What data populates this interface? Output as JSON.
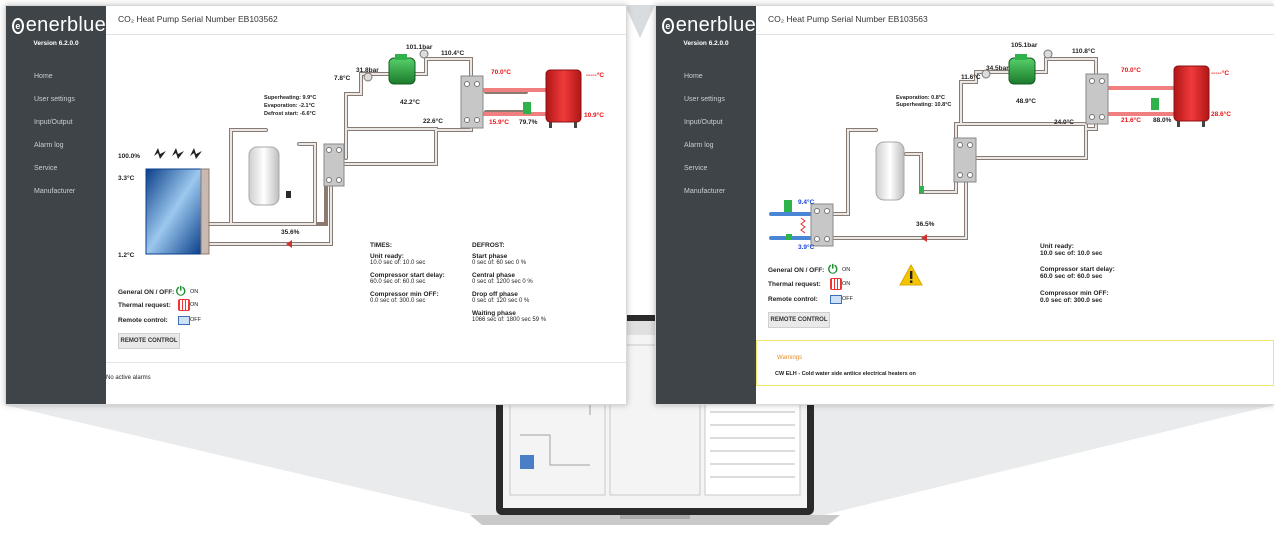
{
  "brand": {
    "logo_text": "enerblue",
    "logo_mark": "e",
    "version": "Version 6.2.0.0"
  },
  "nav": [
    "Home",
    "User settings",
    "Input/Output",
    "Alarm log",
    "Service",
    "Manufacturer"
  ],
  "left": {
    "title": "CO₂ Heat Pump Serial Number EB103562",
    "labels": {
      "p_high": "101.1bar",
      "t_discharge": "110.4°C",
      "p_low": "31.8bar",
      "t_suction": "7.8°C",
      "t_comp": "42.2°C",
      "t_supply": "70.0°C",
      "t_tank": "-----°C",
      "t_return": "15.9°C",
      "valve": "79.7%",
      "t_outlet": "10.9°C",
      "t_gc_out": "22.6°C",
      "fan": "100.0%",
      "t_air": "3.3°C",
      "t_coil": "1.2°C",
      "exp_valve": "35.6%",
      "superheating": "Superheating: 9.9°C",
      "evaporation": "Evaporation:    -2.1°C",
      "defrost_start": "Defrost start:   -6.6°C"
    },
    "status": {
      "general": "General ON / OFF:",
      "general_val": "ON",
      "thermal": "Thermal request:",
      "thermal_val": "ON",
      "remote": "Remote control:",
      "remote_val": "OFF",
      "remote_btn": "REMOTE CONTROL"
    },
    "times": {
      "heading": "TIMES:",
      "l1": "Unit ready:",
      "v1": "10.0 sec   of:    10.0 sec",
      "l2": "Compressor start delay:",
      "v2": "60.0 sec   of:    60.0 sec",
      "l3": "Compressor min OFF:",
      "v3": "0.0 sec    of:    300.0 sec"
    },
    "defrost": {
      "heading": "DEFROST:",
      "l1": "Start phase",
      "v1": "0 sec      of:     60 sec    0 %",
      "l2": "Central phase",
      "v2": "0 sec      of:    1200 sec  0 %",
      "l3": "Drop off phase",
      "v3": "0 sec      of:     120 sec   0 %",
      "l4": "Waiting phase",
      "v4": "1066 sec   of:   1800 sec  59 %"
    },
    "alarm": "No active alarms"
  },
  "right": {
    "title": "CO₂ Heat Pump Serial Number EB103563",
    "labels": {
      "p_high": "105.1bar",
      "t_discharge": "110.8°C",
      "p_low": "34.5bar",
      "t_suction": "11.6°C",
      "t_comp": "48.9°C",
      "t_supply": "70.0°C",
      "t_tank": "-----°C",
      "t_return": "21.6°C",
      "valve": "88.0%",
      "t_outlet": "28.6°C",
      "t_gc_out": "24.0°C",
      "exp_valve": "36.5%",
      "t_water_in": "9.4°C",
      "t_water_out": "3.9°C",
      "evaporation": "Evaporation:      0.8°C",
      "superheating": "Superheating: 10.8°C"
    },
    "status": {
      "general": "General ON / OFF:",
      "general_val": "ON",
      "thermal": "Thermal request:",
      "thermal_val": "ON",
      "remote": "Remote control:",
      "remote_val": "OFF",
      "remote_btn": "REMOTE CONTROL"
    },
    "times": {
      "l1": "Unit ready:",
      "v1": "10.0 sec   of:    10.0 sec",
      "l2": "Compressor start delay:",
      "v2": "60.0 sec   of:    60.0 sec",
      "l3": "Compressor min OFF:",
      "v3": "0.0 sec    of:    300.0 sec"
    },
    "warning_title": "Warnings",
    "warning_text": "CW ELH - Cold water side antiice electrical heaters on"
  },
  "colors": {
    "sidebar": "#3e4448",
    "on": "#1a8c2c",
    "hot": "#e11111",
    "cold": "#1a47d6",
    "warning": "#f5c400",
    "warning_title": "#f08a24",
    "tank": "#d91f1f",
    "compressor": "#2eb34a"
  }
}
